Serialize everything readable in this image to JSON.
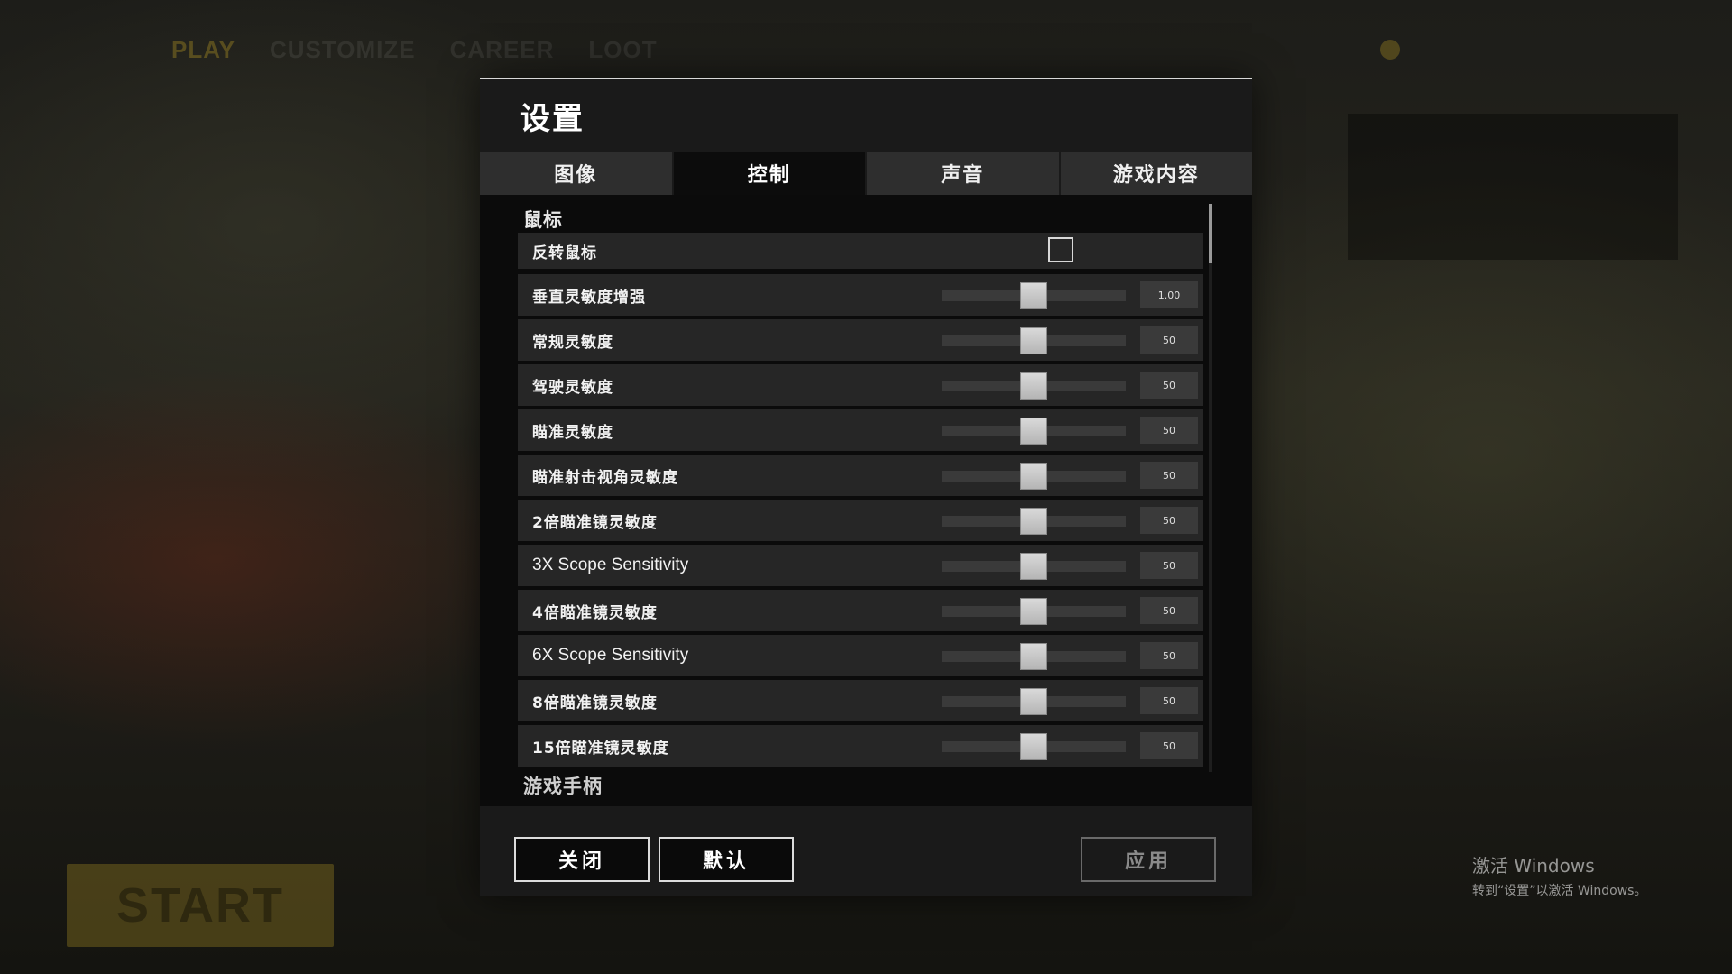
{
  "dialog": {
    "title": "设置",
    "tabs": [
      {
        "label": "图像",
        "active": false
      },
      {
        "label": "控制",
        "active": true
      },
      {
        "label": "声音",
        "active": false
      },
      {
        "label": "游戏内容",
        "active": false
      }
    ]
  },
  "mouse_section": {
    "title": "鼠标",
    "invert_mouse": {
      "label": "反转鼠标",
      "checked": false
    },
    "sliders": [
      {
        "label": "垂直灵敏度增强",
        "value": "1.00",
        "level": 0.5
      },
      {
        "label": "常规灵敏度",
        "value": "50",
        "level": 0.5
      },
      {
        "label": "驾驶灵敏度",
        "value": "50",
        "level": 0.5
      },
      {
        "label": "瞄准灵敏度",
        "value": "50",
        "level": 0.5
      },
      {
        "label": "瞄准射击视角灵敏度",
        "value": "50",
        "level": 0.5
      },
      {
        "label": "2倍瞄准镜灵敏度",
        "value": "50",
        "level": 0.5
      },
      {
        "label": "3X Scope Sensitivity",
        "value": "50",
        "level": 0.5
      },
      {
        "label": "4倍瞄准镜灵敏度",
        "value": "50",
        "level": 0.5
      },
      {
        "label": "6X Scope Sensitivity",
        "value": "50",
        "level": 0.5
      },
      {
        "label": "8倍瞄准镜灵敏度",
        "value": "50",
        "level": 0.5
      },
      {
        "label": "15倍瞄准镜灵敏度",
        "value": "50",
        "level": 0.5
      }
    ]
  },
  "next_section": {
    "title": "游戏手柄"
  },
  "footer": {
    "close_label": "关闭",
    "default_label": "默认",
    "apply_label": "应用"
  },
  "watermark": {
    "title": "激活 Windows",
    "subtitle": "转到“设置”以激活 Windows。"
  },
  "background": {
    "top_nav": [
      "PLAY",
      "CUSTOMIZE",
      "CAREER",
      "LOOT"
    ],
    "start_label": "START"
  }
}
